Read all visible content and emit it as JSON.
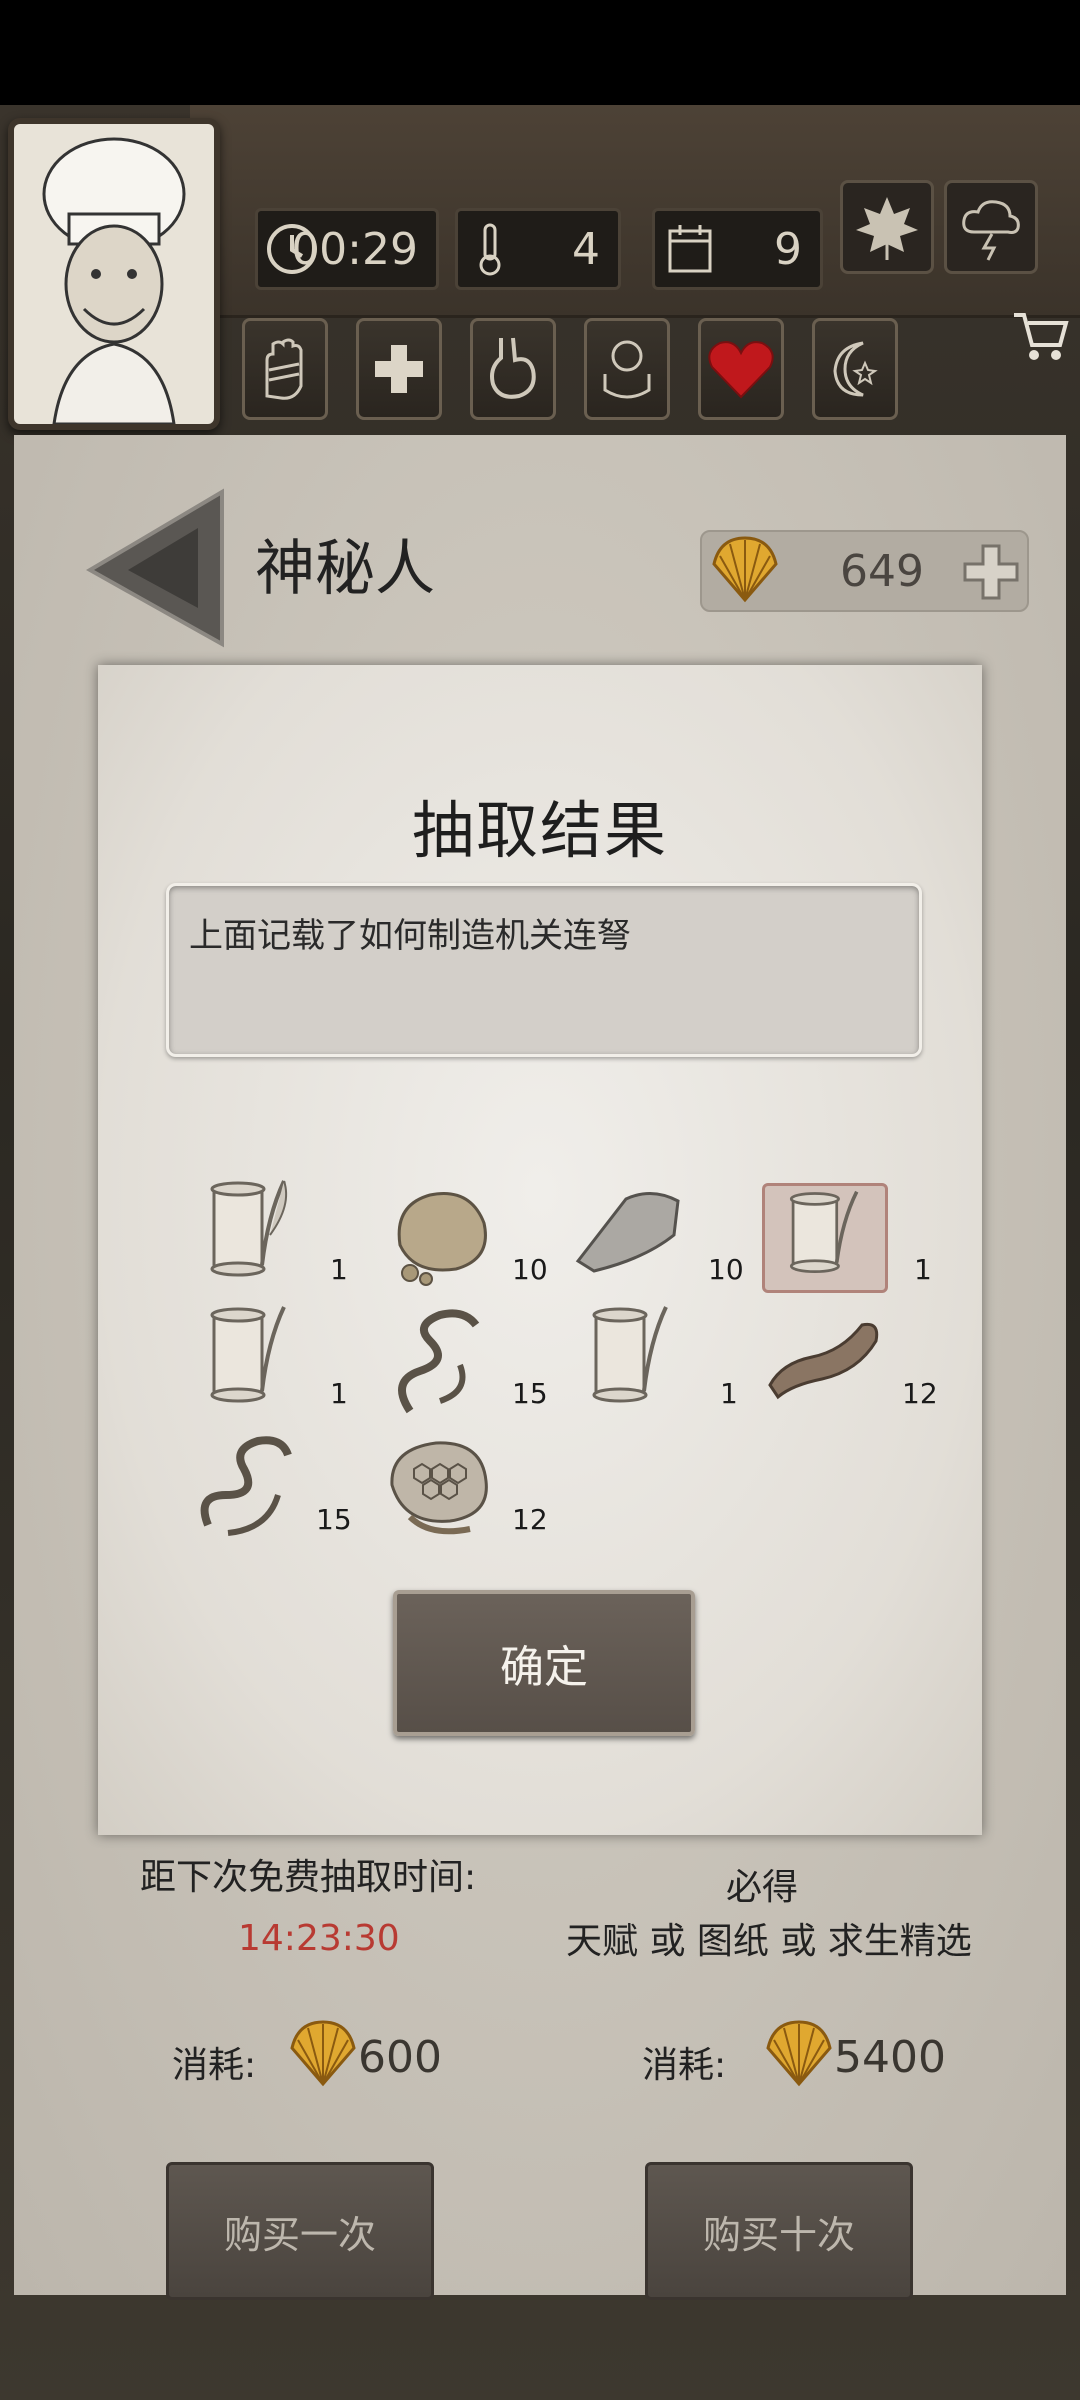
{
  "hud": {
    "timer": "00:29",
    "temperature": "4",
    "day": "9"
  },
  "header": {
    "title": "神秘人",
    "currency_value": "649"
  },
  "dialog": {
    "title": "抽取结果",
    "description": "上面记载了如何制造机关连弩",
    "confirm_label": "确定",
    "items": [
      {
        "icon": "scroll-icon",
        "count": "1"
      },
      {
        "icon": "rock-icon",
        "count": "10"
      },
      {
        "icon": "stone-icon",
        "count": "10"
      },
      {
        "icon": "scroll-icon",
        "count": "1",
        "highlighted": true
      },
      {
        "icon": "scroll-icon",
        "count": "1"
      },
      {
        "icon": "vine-icon",
        "count": "15"
      },
      {
        "icon": "scroll-icon",
        "count": "1"
      },
      {
        "icon": "meat-strip-icon",
        "count": "12"
      },
      {
        "icon": "vine-icon",
        "count": "15"
      },
      {
        "icon": "honeycomb-icon",
        "count": "12"
      }
    ]
  },
  "draw": {
    "free_timer_label": "距下次免费抽取时间:",
    "free_timer_value": "14:23:30",
    "guarantee_label": "必得",
    "guarantee_detail": "天赋 或 图纸 或 求生精选",
    "cost_label": "消耗:",
    "cost_single": "600",
    "cost_ten": "5400",
    "buy_once_label": "购买一次",
    "buy_ten_label": "购买十次"
  },
  "colors": {
    "timer_red": "#b83a32",
    "heart_red": "#c0181c",
    "shell_gold": "#e0a830"
  }
}
